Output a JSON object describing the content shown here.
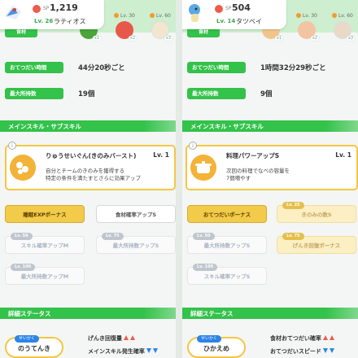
{
  "left": {
    "pokemon": {
      "sp_label": "SP",
      "sp_value": "1,219",
      "level": "Lv. 26",
      "name": "ラティオス",
      "sprite": "latios"
    },
    "ingredients_label": "食材",
    "foods": [
      {
        "level": "",
        "count": "x1",
        "color": "#4aa53a",
        "icon": "green-leaf"
      },
      {
        "level": "Lv. 30",
        "count": "x2",
        "color": "#e8584a",
        "icon": "apple"
      },
      {
        "level": "Lv. 60",
        "count": "x3",
        "color": "#f3e6cf",
        "icon": "egg"
      }
    ],
    "stats": [
      {
        "label": "おてつだい時間",
        "value": "44分20秒ごと"
      },
      {
        "label": "最大所持数",
        "value": "19個"
      }
    ],
    "section_skills": "メインスキル・サブスキル",
    "skill": {
      "info": "i",
      "name": "りゅうせいぐん(きのみバースト)",
      "level": "Lv. 1",
      "desc1": "自分とチームのきのみを獲得する",
      "desc2": "特定の条件を満たすとさらに効果アップ",
      "icon": "berry-burst-icon"
    },
    "subskills": [
      {
        "tag": "",
        "label": "睡眠EXPボーナス",
        "style": "gold"
      },
      {
        "tag": "",
        "label": "食材確率アップS",
        "style": "white"
      },
      {
        "tag": "Lv. 50",
        "label": "スキル確率アップM",
        "style": "fblue"
      },
      {
        "tag": "Lv. 75",
        "label": "最大所持数アップS",
        "style": "fwhite"
      },
      {
        "tag": "Lv. 100",
        "label": "最大所持数アップM",
        "style": "fblue"
      }
    ],
    "section_detail": "詳細ステータス",
    "nature": {
      "label": "せいかく",
      "name": "のうてんき"
    },
    "detail": [
      {
        "label": "げんき回復量",
        "dir": "up"
      },
      {
        "label": "メインスキル発生確率",
        "dir": "down"
      }
    ]
  },
  "right": {
    "pokemon": {
      "sp_label": "SP",
      "sp_value": "504",
      "level": "Lv. 14",
      "name": "タツベイ",
      "sprite": "bagon"
    },
    "ingredients_label": "食材",
    "foods": [
      {
        "level": "",
        "count": "x1",
        "color": "#f2c48a",
        "icon": "potato"
      },
      {
        "level": "Lv. 30",
        "count": "x2",
        "color": "#f3c4a3",
        "icon": "bread"
      },
      {
        "level": "Lv. 60",
        "count": "x3",
        "color": "#e8d9c9",
        "icon": "egg"
      }
    ],
    "stats": [
      {
        "label": "おてつだい時間",
        "value": "1時間32分29秒ごと"
      },
      {
        "label": "最大所持数",
        "value": "9個"
      }
    ],
    "section_skills": "メインスキル・サブスキル",
    "skill": {
      "info": "i",
      "name": "料理パワーアップS",
      "level": "Lv. 1",
      "desc1": "次回の料理でなべの容量を",
      "desc2": "7個増やす",
      "icon": "pot-icon"
    },
    "subskills": [
      {
        "tag": "",
        "label": "おてつだいボーナス",
        "style": "gold"
      },
      {
        "tag": "Lv. 25",
        "label": "きのみの数S",
        "style": "fgold"
      },
      {
        "tag": "Lv. 50",
        "label": "最大所持数アップS",
        "style": "fwhite"
      },
      {
        "tag": "Lv. 75",
        "label": "げんき回復ボーナス",
        "style": "fgold"
      },
      {
        "tag": "Lv. 100",
        "label": "スキル確率アップS",
        "style": "fwhite"
      }
    ],
    "section_detail": "詳細ステータス",
    "nature": {
      "label": "せいかく",
      "name": "ひかえめ"
    },
    "detail": [
      {
        "label": "食材おてつだい確率",
        "dir": "up"
      },
      {
        "label": "おてつだいスピード",
        "dir": "down"
      }
    ]
  }
}
